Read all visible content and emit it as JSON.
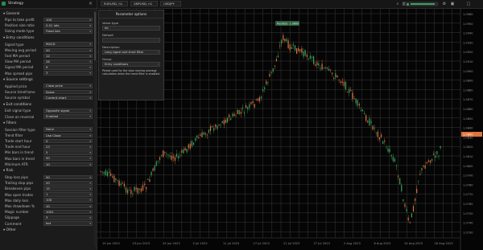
{
  "left_panel": {
    "title": "Strategy",
    "sections": [
      {
        "title": "General",
        "rows": [
          {
            "label": "Pips to take profit",
            "value": "100"
          },
          {
            "label": "Position size ratio",
            "value": "0.01 lots"
          },
          {
            "label": "Sizing mode type",
            "value": "Fixed lots"
          }
        ]
      },
      {
        "title": "Entry conditions",
        "rows": [
          {
            "label": "Signal type",
            "value": "MACD"
          },
          {
            "label": "Moving avg period",
            "value": "20"
          },
          {
            "label": "Fast MA period",
            "value": "12"
          },
          {
            "label": "Slow MA period",
            "value": "26"
          },
          {
            "label": "Signal MA period",
            "value": "9"
          },
          {
            "label": "Max spread pips",
            "value": "3"
          }
        ]
      },
      {
        "title": "Source settings",
        "rows": [
          {
            "label": "Applied price",
            "value": "Close price"
          },
          {
            "label": "Source timeframe",
            "value": "Same"
          },
          {
            "label": "Source symbol",
            "value": "Current chart"
          }
        ]
      },
      {
        "title": "Exit conditions",
        "rows": [
          {
            "label": "Exit signal type",
            "value": "Opposite signal"
          },
          {
            "label": "Close on reversal",
            "value": "Enabled"
          }
        ]
      },
      {
        "title": "Filters",
        "rows": [
          {
            "label": "Session filter type",
            "value": "None"
          },
          {
            "label": "Trend filter",
            "value": "Use Close"
          },
          {
            "label": "Trade start hour",
            "value": "0"
          },
          {
            "label": "Trade end hour",
            "value": "23"
          },
          {
            "label": "Min bars in trend",
            "value": "5"
          },
          {
            "label": "Max bars in trend",
            "value": "50"
          },
          {
            "label": "Minimum ATR",
            "value": "10"
          }
        ]
      },
      {
        "title": "Risk",
        "rows": [
          {
            "label": "Stop loss pips",
            "value": "50"
          },
          {
            "label": "Trailing stop pips",
            "value": "20"
          },
          {
            "label": "Breakeven pips",
            "value": "15"
          },
          {
            "label": "Max open trades",
            "value": "1"
          },
          {
            "label": "Max daily loss",
            "value": "100"
          },
          {
            "label": "Max drawdown %",
            "value": "10"
          },
          {
            "label": "Magic number",
            "value": "1001"
          },
          {
            "label": "Slippage",
            "value": "3"
          },
          {
            "label": "Comment",
            "value": "bot"
          }
        ]
      },
      {
        "title": "Other",
        "rows": []
      }
    ]
  },
  "topbar": {
    "tabs": [
      "EURUSD, h1",
      "GBPUSD, h1",
      "USDJPY"
    ]
  },
  "popup": {
    "title": "Parameter options",
    "fields": [
      {
        "label": "Value type",
        "value": "Int"
      },
      {
        "label": "Default",
        "value": ""
      },
      {
        "label": "Description",
        "value": "Long signal and short filter"
      },
      {
        "label": "Group",
        "value": "Entry conditions"
      }
    ],
    "description": "Period used for the slow moving average calculation when the trend filter is enabled."
  },
  "chart": {
    "marker_label": "Position: 1.0800",
    "time_labels": [
      "19 Jun 2023",
      "23 Jun 2023",
      "29 Jun 2023",
      "5 Jul 2023",
      "11 Jul 2023",
      "17 Jul 2023",
      "21 Jul 2023",
      "27 Jul 2023",
      "2 Aug 2023",
      "8 Aug 2023",
      "14 Aug 2023",
      "18 Aug 2023"
    ],
    "price_labels": [
      "1.0960",
      "1.0950",
      "1.0940",
      "1.0930",
      "1.0920",
      "1.0910",
      "1.0900",
      "1.0890",
      "1.0880",
      "1.0870",
      "1.0860",
      "1.0850",
      "1.0840",
      "1.0830",
      "1.0820",
      "1.0810",
      "1.0800",
      "1.0790",
      "1.0780",
      "1.0770",
      "1.0760",
      "1.0750",
      "1.0740",
      "1.0730"
    ],
    "current_price": "1.0800"
  },
  "colors": {
    "up": "#3aa362",
    "down": "#e0733a",
    "grid": "#3a3a3a",
    "background": "#050505"
  }
}
